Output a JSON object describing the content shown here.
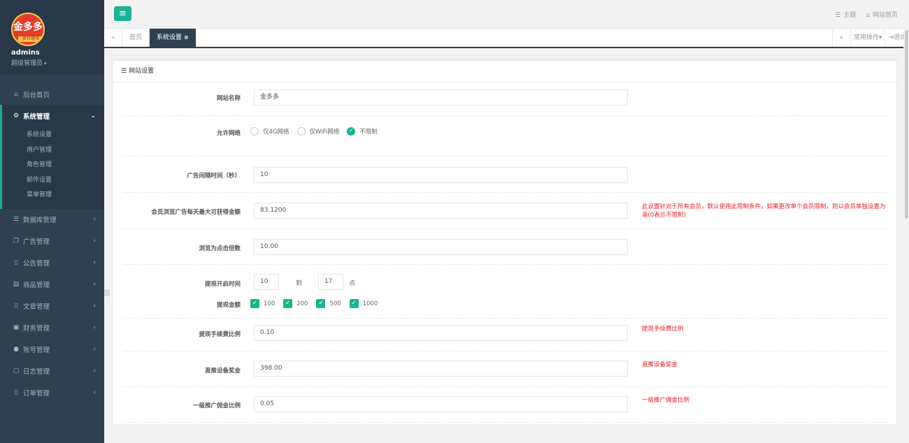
{
  "user": {
    "name": "admins",
    "role": "超级管理员",
    "logo_text": "金多多",
    "logo_band": "疯狂赚钱"
  },
  "sidebar": {
    "items": [
      {
        "label": "后台首页",
        "icon": "home-icon"
      },
      {
        "label": "系统管理",
        "icon": "gear-icon",
        "sub": [
          "系统设置",
          "用户管理",
          "角色管理",
          "邮件设置",
          "菜单管理"
        ]
      },
      {
        "label": "数据库管理",
        "icon": "database-icon"
      },
      {
        "label": "广告管理",
        "icon": "copy-icon"
      },
      {
        "label": "公告管理",
        "icon": "file-icon"
      },
      {
        "label": "商品管理",
        "icon": "archive-icon"
      },
      {
        "label": "文章管理",
        "icon": "file-icon"
      },
      {
        "label": "财务管理",
        "icon": "money-icon"
      },
      {
        "label": "账号管理",
        "icon": "user-icon"
      },
      {
        "label": "日志管理",
        "icon": "calendar-icon"
      },
      {
        "label": "订单管理",
        "icon": "file-text-icon"
      }
    ]
  },
  "topbar": {
    "theme": "主题",
    "site_home": "网站首页"
  },
  "tabs": {
    "home": "首页",
    "current": "系统设置",
    "common_ops": "常用操作",
    "logout": "退出"
  },
  "panel": {
    "title": "网站设置"
  },
  "form": {
    "site_name": {
      "label": "网站名称",
      "value": "金多多"
    },
    "network": {
      "label": "允许网络",
      "options": [
        "仅4G网络",
        "仅WiFi网络",
        "不限制"
      ],
      "selected": "不限制"
    },
    "ad_interval": {
      "label": "广告间隔时间（秒）",
      "value": "10"
    },
    "max_earn": {
      "label": "会员浏览广告每天最大可获得金额",
      "value": "83.1200",
      "hint": "此设置针对于所有会员，默认使用此限制条件，如果更改单个会员限制，则以会员单独设置为准(0表示不限制)"
    },
    "click_multiple": {
      "label": "浏览为点击倍数",
      "value": "10.00"
    },
    "withdraw_time": {
      "label": "提现开启时间",
      "start": "10",
      "to": "到",
      "end": "17",
      "unit": "点"
    },
    "withdraw_amount": {
      "label": "提现金额",
      "options": [
        "100",
        "200",
        "500",
        "1000"
      ]
    },
    "fee_ratio": {
      "label": "提现手续费比例",
      "value": "0.10",
      "hint": "提现手续费比例"
    },
    "device_bonus": {
      "label": "直推设备奖金",
      "value": "398.00",
      "hint": "直推设备奖金"
    },
    "commission": {
      "label": "一级推广佣金比例",
      "value": "0.05",
      "hint": "一级推广佣金比例"
    }
  },
  "colors": {
    "accent": "#1ab394",
    "sidebar": "#2f4050",
    "hint": "#ed1c24"
  }
}
